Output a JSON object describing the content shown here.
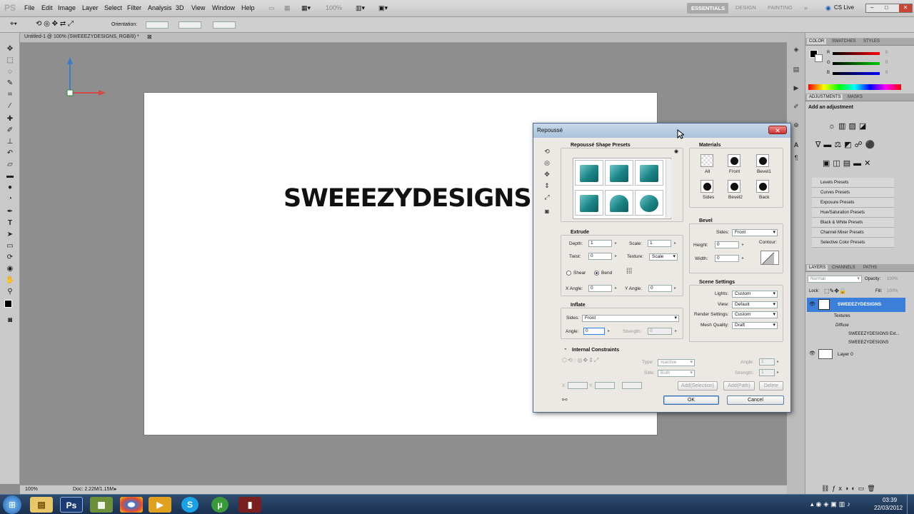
{
  "app": {
    "logo": "PS"
  },
  "menu": [
    "File",
    "Edit",
    "Image",
    "Layer",
    "Select",
    "Filter",
    "Analysis",
    "3D",
    "View",
    "Window",
    "Help"
  ],
  "zoom_display": "100%",
  "workspaces": [
    "ESSENTIALS",
    "DESIGN",
    "PAINTING"
  ],
  "cs_live": "CS Live",
  "options_bar": {
    "orientation_label": "Orientation:"
  },
  "document": {
    "tab_title": "Untitled-1 @ 100% (SWEEEZYDESIGNS, RGB/8) *",
    "canvas_text": "SWEEEZYDESIGNS",
    "status_zoom": "100%",
    "status_doc": "Doc: 2.22M/1.15M"
  },
  "color_panel": {
    "tabs": [
      "COLOR",
      "SWATCHES",
      "STYLES"
    ],
    "labels": [
      "R",
      "G",
      "B"
    ],
    "values": [
      "0",
      "0",
      "0"
    ]
  },
  "adjustments_panel": {
    "tabs": [
      "ADJUSTMENTS",
      "MASKS"
    ],
    "heading": "Add an adjustment",
    "presets": [
      "Levels Presets",
      "Curves Presets",
      "Exposure Presets",
      "Hue/Saturation Presets",
      "Black & White Presets",
      "Channel Mixer Presets",
      "Selective Color Presets"
    ]
  },
  "layers_panel": {
    "tabs": [
      "LAYERS",
      "CHANNELS",
      "PATHS"
    ],
    "blend_mode": "Normal",
    "opacity_label": "Opacity:",
    "opacity": "100%",
    "lock_label": "Lock:",
    "fill_label": "Fill:",
    "fill": "100%",
    "layers": [
      "SWEEEZYDESIGNS",
      "Textures",
      "Diffuse",
      "SWEEEZYDESIGNS Ext...",
      "SWEEEZYDESIGNS",
      "Layer 0"
    ]
  },
  "dialog": {
    "title": "Repoussé",
    "shape_presets_title": "Repoussé Shape Presets",
    "materials": {
      "title": "Materials",
      "slots": [
        "All",
        "Front",
        "Bevel1",
        "Sides",
        "Bevel2",
        "Back"
      ]
    },
    "extrude": {
      "title": "Extrude",
      "depth_label": "Depth:",
      "depth": "1",
      "scale_label": "Scale:",
      "scale": "1",
      "twist_label": "Twist:",
      "twist": "0",
      "texture_label": "Texture:",
      "texture": "Scale",
      "shear_label": "Shear",
      "bend_label": "Bend",
      "x_angle_label": "X Angle:",
      "x_angle": "0",
      "y_angle_label": "Y Angle:",
      "y_angle": "0"
    },
    "bevel": {
      "title": "Bevel",
      "sides_label": "Sides:",
      "sides": "Front",
      "height_label": "Height:",
      "height": "0",
      "width_label": "Width:",
      "width": "0",
      "contour_label": "Contour:"
    },
    "inflate": {
      "title": "Inflate",
      "sides_label": "Sides:",
      "sides": "Front",
      "angle_label": "Angle:",
      "angle": "0",
      "strength_label": "Strength:",
      "strength": "0"
    },
    "scene": {
      "title": "Scene Settings",
      "lights_label": "Lights:",
      "lights": "Custom",
      "view_label": "View:",
      "view": "Default",
      "render_label": "Render Settings:",
      "render": "Custom",
      "mesh_label": "Mesh Quality:",
      "mesh": "Draft"
    },
    "constraints": {
      "title": "Internal Constraints",
      "type_label": "Type:",
      "type": "Inactive",
      "side_label": "Side:",
      "side": "Both",
      "angle_label": "Angle:",
      "angle": "1",
      "strength_label": "Strength:",
      "strength": "1",
      "x_label": "X:",
      "y_label": "Y:",
      "add_selection": "Add(Selection)",
      "add_path": "Add(Path)",
      "delete": "Delete"
    },
    "ok": "OK",
    "cancel": "Cancel"
  },
  "taskbar": {
    "time": "03:39",
    "date": "22/03/2012"
  }
}
